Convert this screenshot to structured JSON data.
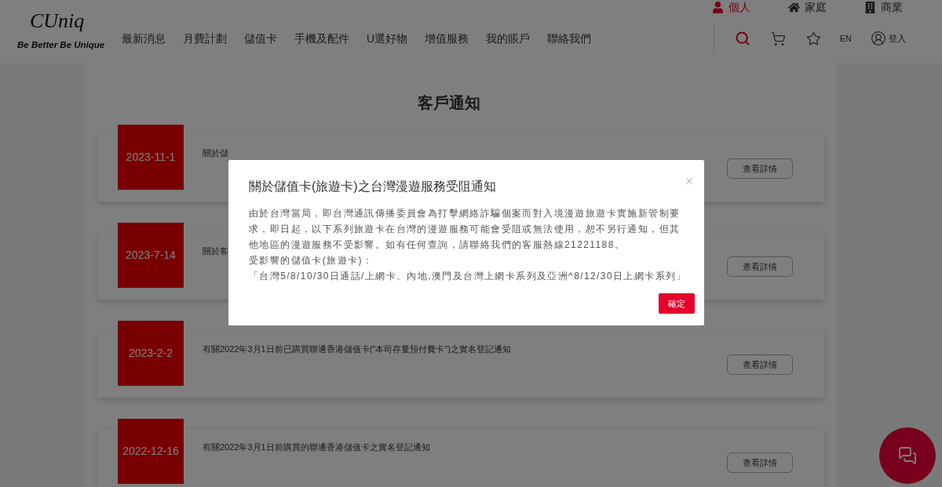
{
  "logo": {
    "wordmark": "CUniq",
    "tagline": "Be Better Be Unique"
  },
  "segments": [
    {
      "label": "個人",
      "selected": true,
      "kind": "person"
    },
    {
      "label": "家庭",
      "selected": false,
      "kind": "home"
    },
    {
      "label": "商業",
      "selected": false,
      "kind": "business"
    }
  ],
  "nav": [
    "最新消息",
    "月費計劃",
    "儲值卡",
    "手機及配件",
    "U選好物",
    "增值服務",
    "我的賬戶",
    "聯絡我們"
  ],
  "header_actions": {
    "language": "EN",
    "login": "登入"
  },
  "page_title": "客戶通知",
  "notices": [
    {
      "date": "2023-11-1",
      "title": "關於儲",
      "button": "查看詳情"
    },
    {
      "date": "2023-7-14",
      "title": "關於客",
      "button": "查看詳情"
    },
    {
      "date": "2023-2-2",
      "title": "有關2022年3月1日前已購買聯通香港儲值卡(\"本司存量預付費卡\")之實名登記通知",
      "button": "查看詳情"
    },
    {
      "date": "2022-12-16",
      "title": "有關2022年3月1日前購買的聯通香港儲值卡之實名登記通知",
      "button": "查看詳情"
    }
  ],
  "modal": {
    "title": "關於儲值卡(旅遊卡)之台灣漫遊服務受阻通知",
    "paragraphs": [
      "由於台灣當局，即台灣通訊傳播委員會為打擊網絡詐騙個案而對入境漫遊旅遊卡實施新管制要求，即日起，以下系列旅遊卡在台灣的漫遊服務可能會受阻或無法使用，恕不另行通知，但其他地區的漫遊服務不受影響。如有任何查詢，請聯絡我們的客服熱線21221188。",
      "受影響的儲值卡(旅遊卡)：",
      "「台灣5/8/10/30日通話/上網卡、內地,澳門及台灣上網卡系列及亞洲^8/12/30日上網卡系列」"
    ],
    "confirm": "確定"
  }
}
